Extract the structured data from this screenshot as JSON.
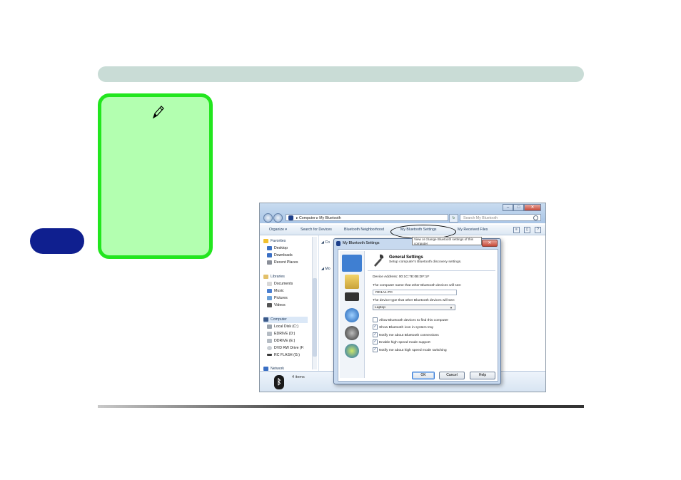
{
  "explorer": {
    "breadcrumb": "▸ Computer ▸ My Bluetooth",
    "search_placeholder": "Search My Bluetooth",
    "toolbar": {
      "organize": "Organize ▾",
      "search_devices": "Search for Devices",
      "neighborhood": "Bluetooth Neighborhood",
      "my_settings": "My Bluetooth Settings",
      "received_files": "My Received Files"
    },
    "tooltip": "View or change Bluetooth settings of this computer",
    "favorites": {
      "heading": "Favorites",
      "items": [
        "Desktop",
        "Downloads",
        "Recent Places"
      ]
    },
    "libraries": {
      "heading": "Libraries",
      "items": [
        "Documents",
        "Music",
        "Pictures",
        "Videos"
      ]
    },
    "computer": {
      "heading": "Computer",
      "items": [
        "Local Disk (C:)",
        "EDRIVE (D:)",
        "DDRIVE (E:)",
        "DVD RW Drive (F:",
        "RC FLASH (G:)"
      ]
    },
    "network": "Network",
    "content_head_1": "◢ Co",
    "content_head_2": "◢ Mo",
    "status_count": "4 items"
  },
  "dialog": {
    "title": "My Bluetooth Settings",
    "close": "✕",
    "header_title": "General Settings",
    "header_sub": "Setup computer's Bluetooth discovery settings.",
    "device_address": "Device Address:  00:1C:7E:0B:DF:1F",
    "name_label": "The computer name that other Bluetooth devices will see:",
    "name_value": "RD1A1-PC",
    "type_label": "The device type that other Bluetooth devices will see:",
    "type_value": "Laptop",
    "checkboxes": [
      {
        "label": "Allow Bluetooth devices to find this computer",
        "checked": false
      },
      {
        "label": "Show Bluetooth icon in system tray",
        "checked": true
      },
      {
        "label": "Notify me about Bluetooth connections",
        "checked": true
      },
      {
        "label": "Enable high speed mode support",
        "checked": true
      },
      {
        "label": "Notify me about high speed mode switching",
        "checked": true
      }
    ],
    "buttons": {
      "ok": "OK",
      "cancel": "Cancel",
      "help": "Help"
    }
  },
  "colors": {
    "header_bar": "#c9dcd6",
    "chapter_tab": "#0f1f8f",
    "note_fill": "#b3ffb0",
    "note_border": "#22e61e"
  },
  "icons": [
    "pencil-icon",
    "bluetooth-icon",
    "wrench-icon"
  ]
}
